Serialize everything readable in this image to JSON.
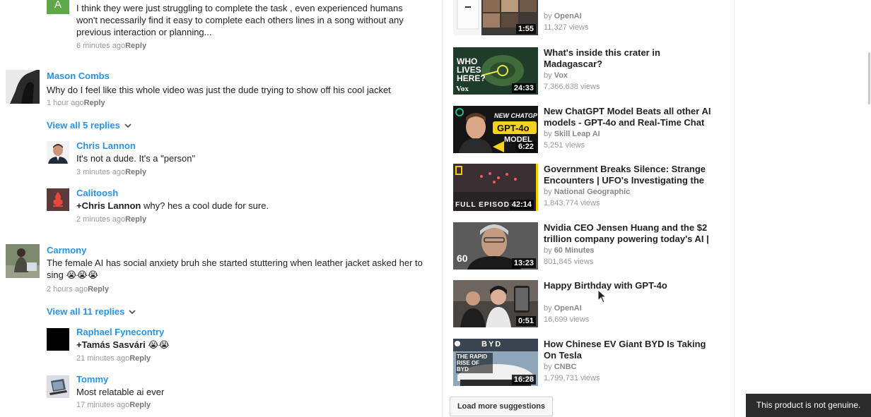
{
  "comments": [
    {
      "avatar_letter": "A",
      "text": "I think they were just struggling to complete the task , even experienced humans won't necessarily find it easy to complete each others lines in a song without any previous interaction or planning...",
      "time": "6 minutes ago",
      "reply": "Reply"
    },
    {
      "author": "Mason Combs",
      "text": "Why do I feel like this whole video was just the dude trying to show off his cool jacket",
      "time": "1 hour ago",
      "reply": "Reply",
      "view_replies": "View all 5 replies",
      "replies": [
        {
          "author": "Chris Lannon",
          "text": "It's not a dude. It's a \"person\"",
          "time": "3 minutes ago",
          "reply": "Reply"
        },
        {
          "author": "Calitoosh",
          "mention": "+Chris Lannon",
          "text": " why? hes a cool dude for sure.",
          "time": "2 minutes ago",
          "reply": "Reply"
        }
      ]
    },
    {
      "author": "Carmony",
      "text": "The female AI has social anxiety bruh she started stuttering when leather jacket asked her to sing 😭😭😭",
      "time": "2 hours ago",
      "reply": "Reply",
      "view_replies": "View all 11 replies",
      "replies": [
        {
          "author": "Raphael Fynecontry",
          "mention": "+Tamás Sasvári",
          "text": " 😭😭",
          "time": "21 minutes ago",
          "reply": "Reply"
        },
        {
          "author": "Tommy",
          "text": "Most relatable ai ever",
          "time": "17 minutes ago",
          "reply": "Reply"
        }
      ]
    }
  ],
  "suggestions": [
    {
      "title": "",
      "by_prefix": "by",
      "channel": "OpenAI",
      "views": "11,327 views",
      "duration": "1:55"
    },
    {
      "title": "What's inside this crater in Madagascar?",
      "by_prefix": "by",
      "channel": "Vox",
      "views": "7,366,638 views",
      "duration": "24:33",
      "thumb_text": "WHO LIVES HERE?",
      "thumb_brand": "Vox"
    },
    {
      "title": "New ChatGPT Model Beats all other AI models - GPT-4o and Real-Time Chat",
      "by_prefix": "by",
      "channel": "Skill Leap AI",
      "views": "5,251 views",
      "duration": "6:22",
      "thumb_text": "NEW CHATGPT",
      "thumb_text2": "GPT-4o",
      "thumb_text3": "MODEL"
    },
    {
      "title": "Government Breaks Silence: Strange Encounters | UFO's Investigating the",
      "by_prefix": "by",
      "channel": "National Geographic",
      "views": "1,843,774 views",
      "duration": "42:14",
      "thumb_text": "FULL EPISODE"
    },
    {
      "title": "Nvidia CEO Jensen Huang and the $2 trillion company powering today's AI |",
      "by_prefix": "by",
      "channel": "60 Minutes",
      "views": "801,845 views",
      "duration": "13:23",
      "thumb_text": "60"
    },
    {
      "title": "Happy Birthday with GPT-4o",
      "by_prefix": "by",
      "channel": "OpenAI",
      "views": "16,699 views",
      "duration": "0:51"
    },
    {
      "title": "How Chinese EV Giant BYD Is Taking On Tesla",
      "by_prefix": "by",
      "channel": "CNBC",
      "views": "1,799,731 views",
      "duration": "16:28",
      "thumb_text": "THE RAPID RISE OF BYD",
      "thumb_brand": "BYD"
    }
  ],
  "load_more": "Load more suggestions",
  "toast": "This product is not genuine.",
  "colors": {
    "link_blue": "#2793e6",
    "avatar_green": "#5fa84a",
    "meta_gray": "#999999"
  }
}
